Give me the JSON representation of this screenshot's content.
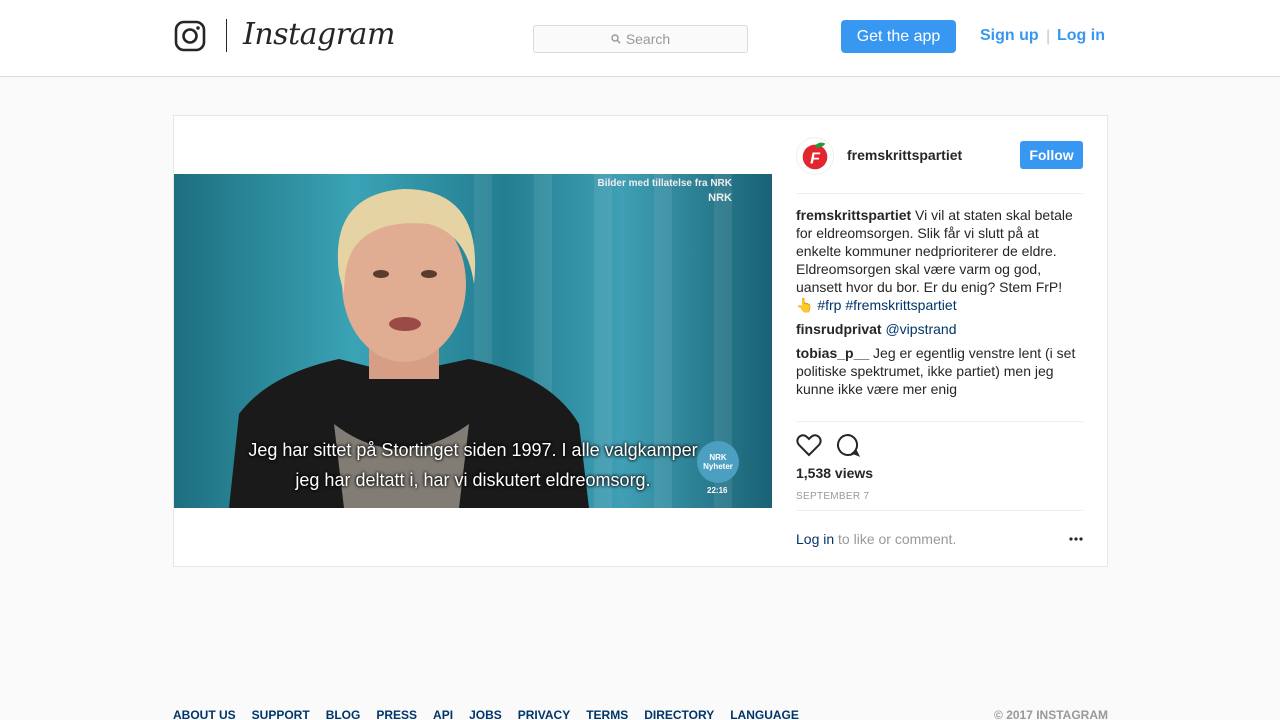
{
  "header": {
    "logo_text": "Instagram",
    "search_placeholder": "Search",
    "get_app_label": "Get the app",
    "signup_label": "Sign up",
    "separator": "|",
    "login_label": "Log in"
  },
  "post": {
    "video": {
      "credit": "Bilder med tillatelse fra NRK",
      "channel_logo": "NRK",
      "subtitle_line1": "Jeg har sittet på Stortinget siden 1997. I alle valgkamper",
      "subtitle_line2": "jeg har deltatt i, har vi diskutert eldreomsorg.",
      "news_badge": "Nyheter",
      "news_badge_top": "NRK",
      "time": "22:16"
    },
    "author": "fremskrittspartiet",
    "follow_label": "Follow",
    "caption": {
      "user": "fremskrittspartiet",
      "text": "Vi vil at staten skal betale for eldreomsorgen. Slik får vi slutt på at enkelte kommuner nedprioriterer de eldre. Eldreomsorgen skal være varm og god, uansett hvor du bor. Er du enig? Stem FrP! 👆",
      "tags": "#frp #fremskrittspartiet"
    },
    "comments": [
      {
        "user": "finsrudprivat",
        "text": "@vipstrand"
      },
      {
        "user": "tobias_p__",
        "text": "Jeg er egentlig venstre lent (i set politiske spektrumet, ikke partiet) men jeg kunne ikke være mer enig"
      }
    ],
    "views": "1,538 views",
    "date": "SEPTEMBER 7",
    "login_link": "Log in",
    "login_suffix": " to like or comment."
  },
  "footer": {
    "links": [
      "ABOUT US",
      "SUPPORT",
      "BLOG",
      "PRESS",
      "API",
      "JOBS",
      "PRIVACY",
      "TERMS",
      "DIRECTORY",
      "LANGUAGE"
    ],
    "copyright": "© 2017 INSTAGRAM"
  },
  "colors": {
    "accent": "#3897f0",
    "link": "#003569",
    "muted": "#999999",
    "border": "#dbdbdb"
  },
  "icons": [
    "instagram-glyph-icon",
    "search-icon",
    "heart-icon",
    "comment-icon",
    "more-options-icon",
    "frp-logo-icon"
  ]
}
